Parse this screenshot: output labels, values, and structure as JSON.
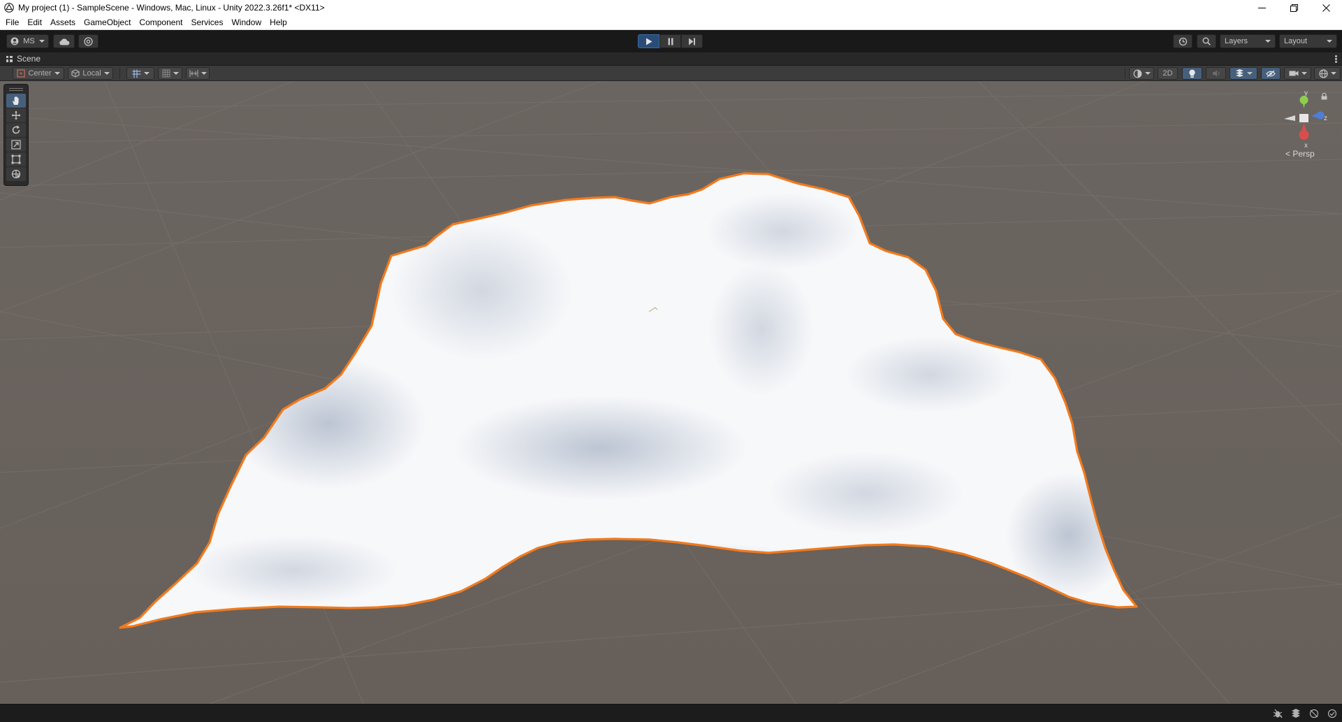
{
  "window": {
    "title": "My project (1) - SampleScene - Windows, Mac, Linux - Unity 2022.3.26f1* <DX11>",
    "controls": [
      "minimize-icon",
      "restore-icon",
      "close-icon"
    ]
  },
  "menubar": {
    "items": [
      "File",
      "Edit",
      "Assets",
      "GameObject",
      "Component",
      "Services",
      "Window",
      "Help"
    ]
  },
  "toolbar": {
    "account_label": "MS",
    "play_controls": [
      "play-icon",
      "pause-icon",
      "step-icon"
    ],
    "play_active": true,
    "layers_label": "Layers",
    "layout_label": "Layout"
  },
  "scene_tab": {
    "label": "Scene"
  },
  "scene_toolbar": {
    "pivot_mode": "Center",
    "pivot_rotation": "Local",
    "mode_2d_label": "2D"
  },
  "tools": [
    "hand-tool-icon",
    "move-tool-icon",
    "rotate-tool-icon",
    "scale-tool-icon",
    "rect-tool-icon",
    "transform-tool-icon"
  ],
  "active_tool": "hand-tool-icon",
  "gizmo": {
    "y_label": "y",
    "z_label": "z",
    "x_label": "x",
    "projection_label": "Persp"
  },
  "colors": {
    "selection_outline": "#f27a1d",
    "grid_background": "#6a635d",
    "play_active": "#294d77",
    "gizmo_y": "#8ccf4d",
    "gizmo_z": "#4d7fd9",
    "gizmo_x": "#d94d4d"
  }
}
